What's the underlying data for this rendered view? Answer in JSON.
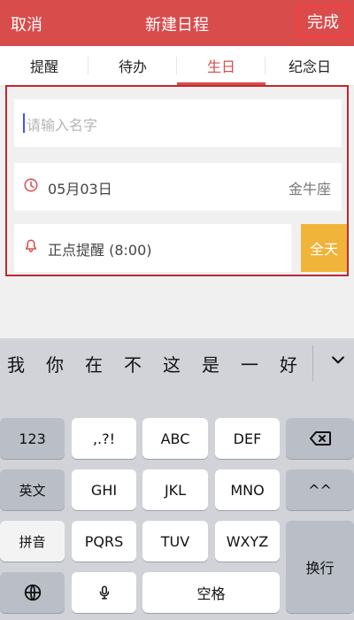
{
  "header": {
    "cancel": "取消",
    "title": "新建日程",
    "done": "完成"
  },
  "tabs": [
    {
      "label": "提醒",
      "active": false
    },
    {
      "label": "待办",
      "active": false
    },
    {
      "label": "生日",
      "active": true
    },
    {
      "label": "纪念日",
      "active": false
    }
  ],
  "form": {
    "name_placeholder": "请输入名字",
    "date": "05月03日",
    "zodiac": "金牛座",
    "reminder": "正点提醒 (8:00)",
    "allday": "全天"
  },
  "keyboard": {
    "candidates": [
      "我",
      "你",
      "在",
      "不",
      "这",
      "是",
      "一",
      "好"
    ],
    "keys": {
      "k123": "123",
      "kpunct": ",.?!",
      "kabc": "ABC",
      "kdef": "DEF",
      "kyingwen": "英文",
      "kghi": "GHI",
      "kjkl": "JKL",
      "kmno": "MNO",
      "kemoji": "^^",
      "kpinyin": "拼音",
      "kpqrs": "PQRS",
      "ktuv": "TUV",
      "kwxyz": "WXYZ",
      "khuanhang": "换行",
      "kspace": "空格"
    }
  },
  "colors": {
    "header": "#d94c4c",
    "allday": "#f0b43a",
    "accent": "#d94c4c"
  }
}
